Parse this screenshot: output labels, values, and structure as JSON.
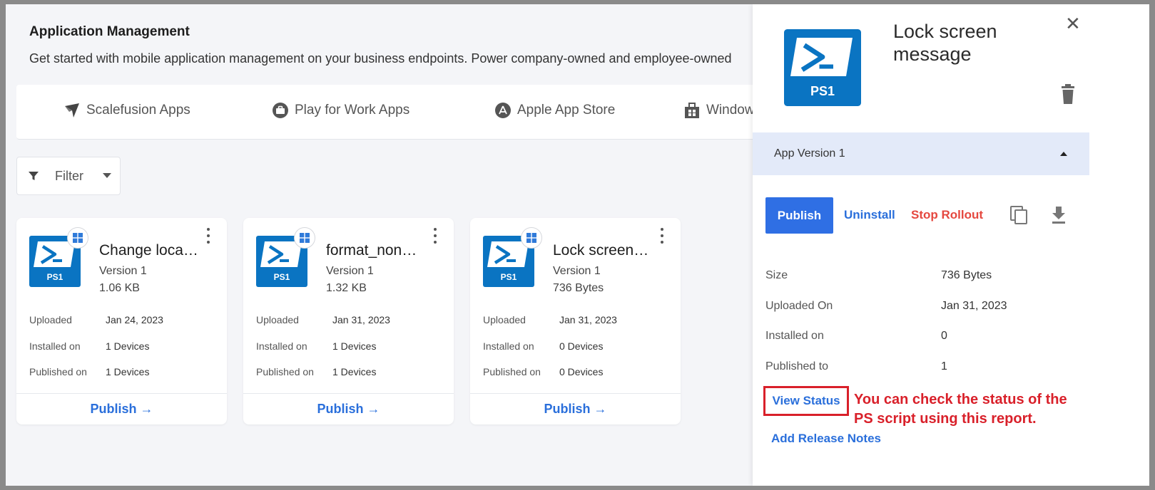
{
  "header": {
    "title": "Application Management",
    "description": "Get started with mobile application management on your business endpoints. Power company-owned and employee-owned"
  },
  "store_tabs": [
    {
      "label": "Scalefusion Apps",
      "icon": "scalefusion-icon"
    },
    {
      "label": "Play for Work Apps",
      "icon": "briefcase-icon"
    },
    {
      "label": "Apple App Store",
      "icon": "app-store-icon"
    },
    {
      "label": "Window",
      "icon": "windows-store-icon"
    }
  ],
  "filter": {
    "label": "Filter"
  },
  "icon_text": "PS1",
  "meta_labels": {
    "uploaded": "Uploaded",
    "installed": "Installed on",
    "published": "Published on"
  },
  "cards": [
    {
      "title": "Change loca…",
      "version": "Version 1",
      "size": "1.06 KB",
      "uploaded": "Jan 24, 2023",
      "installed": "1 Devices",
      "published": "1 Devices",
      "action": "Publish →"
    },
    {
      "title": "format_non…",
      "version": "Version 1",
      "size": "1.32 KB",
      "uploaded": "Jan 31, 2023",
      "installed": "1 Devices",
      "published": "1 Devices",
      "action": "Publish →"
    },
    {
      "title": "Lock screen …",
      "version": "Version 1",
      "size": "736 Bytes",
      "uploaded": "Jan 31, 2023",
      "installed": "0 Devices",
      "published": "0 Devices",
      "action": "Publish →"
    }
  ],
  "panel": {
    "title": "Lock screen message",
    "close": "✕",
    "version_label": "App Version 1",
    "publish": "Publish",
    "uninstall": "Uninstall",
    "stop_rollout": "Stop Rollout",
    "details": [
      {
        "label": "Size",
        "value": "736 Bytes"
      },
      {
        "label": "Uploaded On",
        "value": "Jan 31, 2023"
      },
      {
        "label": "Installed on",
        "value": "0"
      },
      {
        "label": "Published to",
        "value": "1"
      }
    ],
    "view_status": "View Status",
    "add_release_notes": "Add Release Notes",
    "annotation": "You can check the status of the PS script using this report."
  },
  "colors": {
    "accent": "#2f6fe4",
    "link": "#2a6fdb",
    "danger": "#e5483f",
    "annotation": "#d9202a",
    "app_icon": "#0a74c2",
    "version_bar": "#e3eaf9"
  }
}
